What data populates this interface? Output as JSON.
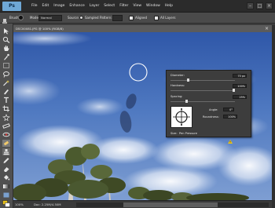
{
  "menu": {
    "logo": "Ps",
    "items": [
      "File",
      "Edit",
      "Image",
      "Enhance",
      "Layer",
      "Select",
      "Filter",
      "View",
      "Window",
      "Help"
    ],
    "window_controls": [
      "–",
      "□",
      "×"
    ]
  },
  "options": {
    "brush_label": "Brush:",
    "mode_label": "Mode:",
    "mode_value": "Normal",
    "source_label": "Source:",
    "sampled_label": "Sampled",
    "pattern_label": "Pattern:",
    "aligned_label": "Aligned",
    "all_layers_label": "All Layers"
  },
  "document": {
    "title": "DSC00081.JPG @ 100% (RGB/8)",
    "close": "×"
  },
  "status": {
    "zoom": "100%",
    "doc_size": "Doc: 2.25M/4.50M"
  },
  "brush_panel": {
    "diameter_label": "Diameter:",
    "diameter_value": "70 px",
    "diameter_fraction": 0.28,
    "hardness_label": "Hardness:",
    "hardness_value": "100%",
    "hardness_fraction": 1.0,
    "spacing_label": "Spacing:",
    "spacing_value": "25%",
    "spacing_fraction": 0.25,
    "angle_label": "Angle:",
    "angle_value": "0°",
    "roundness_label": "Roundness:",
    "roundness_value": "100%",
    "size_label": "Size:",
    "size_value": "Pen Pressure"
  },
  "colors": {
    "accent": "#6fa8d6",
    "warning": "#e8c21a"
  }
}
